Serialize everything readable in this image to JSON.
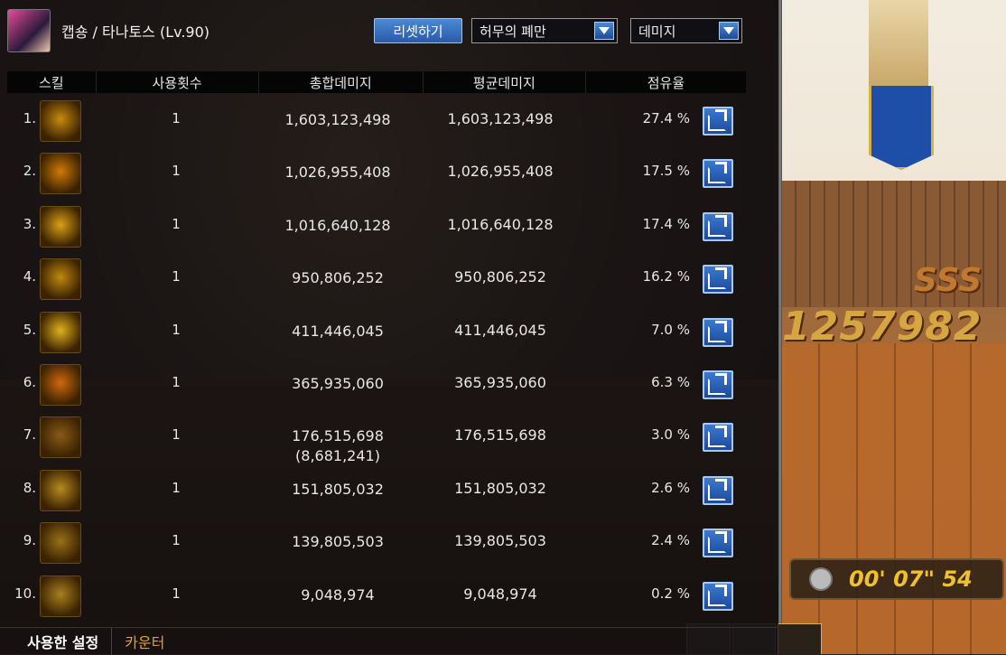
{
  "header": {
    "character": "캡숑 / 타나토스 (Lv.90)",
    "reset_label": "리셋하기",
    "dungeon_select": "허무의 폐만",
    "mode_select": "데미지"
  },
  "columns": {
    "skill": "스킬",
    "count": "사용횟수",
    "total": "총합데미지",
    "avg": "평균데미지",
    "share": "점유율"
  },
  "rows": [
    {
      "rank": "1.",
      "count": "1",
      "total": "1,603,123,498",
      "total_sub": "",
      "avg": "1,603,123,498",
      "share": "27.4 %",
      "icon": "flame-figure-icon",
      "color": "#c98a10"
    },
    {
      "rank": "2.",
      "count": "1",
      "total": "1,026,955,408",
      "total_sub": "",
      "avg": "1,026,955,408",
      "share": "17.5 %",
      "icon": "skulls-icon",
      "color": "#d07a08"
    },
    {
      "rank": "3.",
      "count": "1",
      "total": "1,016,640,128",
      "total_sub": "",
      "avg": "1,016,640,128",
      "share": "17.4 %",
      "icon": "slash-wave-icon",
      "color": "#d8a018"
    },
    {
      "rank": "4.",
      "count": "1",
      "total": "950,806,252",
      "total_sub": "",
      "avg": "950,806,252",
      "share": "16.2 %",
      "icon": "beast-claw-icon",
      "color": "#c08810"
    },
    {
      "rank": "5.",
      "count": "1",
      "total": "411,446,045",
      "total_sub": "",
      "avg": "411,446,045",
      "share": "7.0 %",
      "icon": "skull-icon",
      "color": "#e0b020"
    },
    {
      "rank": "6.",
      "count": "1",
      "total": "365,935,060",
      "total_sub": "",
      "avg": "365,935,060",
      "share": "6.3 %",
      "icon": "fire-spirit-icon",
      "color": "#d06810"
    },
    {
      "rank": "7.",
      "count": "1",
      "total": "176,515,698",
      "total_sub": "(8,681,241)",
      "avg": "176,515,698",
      "share": "3.0 %",
      "icon": "web-icon",
      "color": "#8a5a18"
    },
    {
      "rank": "8.",
      "count": "1",
      "total": "151,805,032",
      "total_sub": "",
      "avg": "151,805,032",
      "share": "2.6 %",
      "icon": "claw-slash-icon",
      "color": "#b88a20"
    },
    {
      "rank": "9.",
      "count": "1",
      "total": "139,805,503",
      "total_sub": "",
      "avg": "139,805,503",
      "share": "2.4 %",
      "icon": "dragon-icon",
      "color": "#9a7018"
    },
    {
      "rank": "10.",
      "count": "1",
      "total": "9,048,974",
      "total_sub": "",
      "avg": "9,048,974",
      "share": "0.2 %",
      "icon": "sword-icon",
      "color": "#a88020"
    }
  ],
  "tabs": {
    "settings": "사용한 설정",
    "counter": "카운터"
  },
  "scene": {
    "rank_badge": "SSS",
    "score": "1257982",
    "timer": "00' 07\" 54"
  }
}
